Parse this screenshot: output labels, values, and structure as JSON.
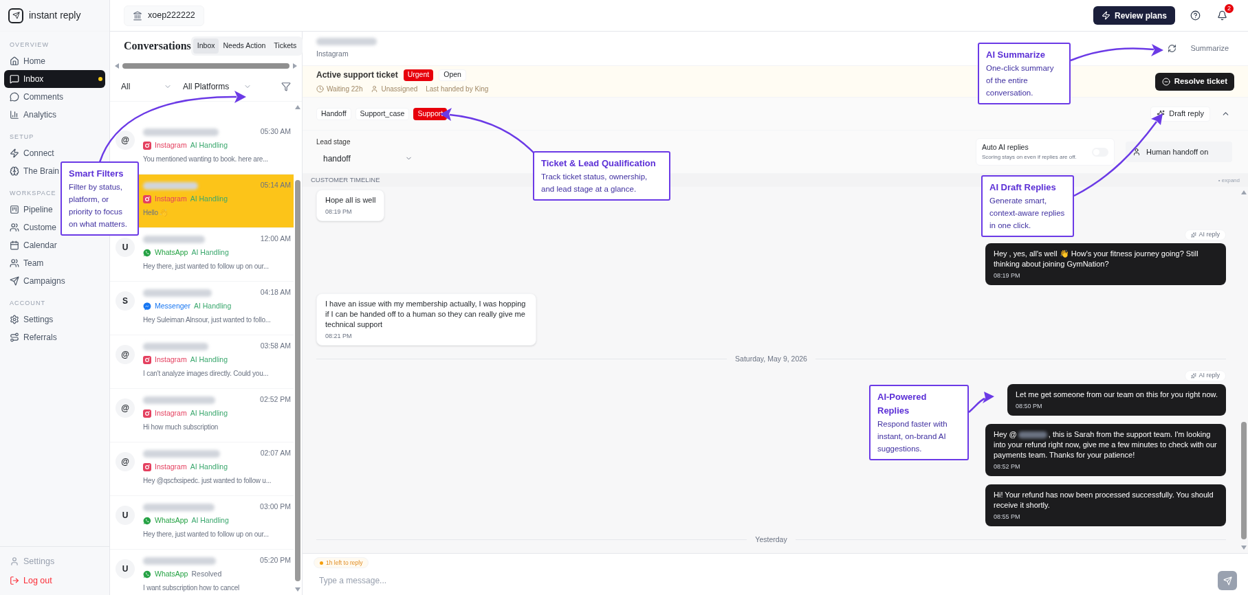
{
  "app": {
    "name": "instant reply"
  },
  "topbar": {
    "workspace": "xoep222222",
    "upgrade_button": "Review plans",
    "notification_count": "2"
  },
  "sidebar": {
    "sections": [
      {
        "title": "OVERVIEW",
        "items": [
          {
            "label": "Home",
            "selected": false,
            "unread": false
          },
          {
            "label": "Inbox",
            "selected": true,
            "unread": true
          },
          {
            "label": "Comments",
            "selected": false,
            "unread": false
          },
          {
            "label": "Analytics",
            "selected": false,
            "unread": false
          }
        ]
      },
      {
        "title": "SETUP",
        "items": [
          {
            "label": "Connect",
            "selected": false,
            "unread": false
          },
          {
            "label": "The Brain",
            "selected": false,
            "unread": false
          }
        ]
      },
      {
        "title": "WORKSPACE",
        "items": [
          {
            "label": "Pipeline",
            "selected": false,
            "unread": false
          },
          {
            "label": "Custome",
            "selected": false,
            "unread": false
          },
          {
            "label": "Calendar",
            "selected": false,
            "unread": false
          },
          {
            "label": "Team",
            "selected": false,
            "unread": false
          },
          {
            "label": "Campaigns",
            "selected": false,
            "unread": false
          }
        ]
      },
      {
        "title": "ACCOUNT",
        "items": [
          {
            "label": "Settings",
            "selected": false,
            "unread": false
          },
          {
            "label": "Referrals",
            "selected": false,
            "unread": false
          }
        ]
      }
    ],
    "footer": [
      {
        "label": "Settings",
        "kind": "normal"
      },
      {
        "label": "Log out",
        "kind": "danger"
      }
    ]
  },
  "conversations": {
    "title": "Conversations",
    "tabs": [
      {
        "label": "Inbox",
        "selected": true
      },
      {
        "label": "Needs Action",
        "selected": false
      },
      {
        "label": "Tickets",
        "selected": false
      }
    ],
    "filters": [
      {
        "value": "All"
      },
      {
        "value": "All Platforms"
      }
    ],
    "items": [
      {
        "avatar": "@",
        "time": "05:30 AM",
        "platform": "Instagram",
        "kind": "instagram",
        "color": "#e4405f",
        "status": "AI Handling",
        "ai_handled": true,
        "preview": "You mentioned wanting to book. here are...",
        "selected": false
      },
      {
        "time": "05:14 AM",
        "platform": "Instagram",
        "kind": "instagram",
        "color": "#e4405f",
        "status": "AI Handling",
        "ai_handled": true,
        "preview": "Hello 👋",
        "selected": true
      },
      {
        "avatar": "U",
        "time": "12:00 AM",
        "platform": "WhatsApp",
        "kind": "whatsapp",
        "color": "#25a244",
        "status": "AI Handling",
        "ai_handled": true,
        "preview": "Hey there, just wanted to follow up on our...",
        "selected": false
      },
      {
        "avatar": "S",
        "time": "04:18 AM",
        "platform": "Messenger",
        "kind": "messenger",
        "color": "#1877f2",
        "status": "AI Handling",
        "ai_handled": true,
        "preview": "Hey Suleiman Alnsour, just wanted to follo...",
        "selected": false
      },
      {
        "avatar": "@",
        "time": "03:58 AM",
        "platform": "Instagram",
        "kind": "instagram",
        "color": "#e4405f",
        "status": "AI Handling",
        "ai_handled": true,
        "preview": "I can't analyze images directly. Could you...",
        "selected": false
      },
      {
        "avatar": "@",
        "time": "02:52 PM",
        "platform": "Instagram",
        "kind": "instagram",
        "color": "#e4405f",
        "status": "AI Handling",
        "ai_handled": true,
        "preview": "Hi how much subscription",
        "selected": false
      },
      {
        "avatar": "@",
        "time": "02:07 AM",
        "platform": "Instagram",
        "kind": "instagram",
        "color": "#e4405f",
        "status": "AI Handling",
        "ai_handled": true,
        "preview": "Hey @qscfxsipedc. just wanted to follow u...",
        "selected": false
      },
      {
        "avatar": "U",
        "time": "03:00 PM",
        "platform": "WhatsApp",
        "kind": "whatsapp",
        "color": "#25a244",
        "status": "AI Handling",
        "ai_handled": true,
        "preview": "Hey there, just wanted to follow up on our...",
        "selected": false
      },
      {
        "avatar": "U",
        "time": "05:20 PM",
        "platform": "WhatsApp",
        "kind": "whatsapp",
        "color": "#25a244",
        "status": "Resolved",
        "ai_handled": false,
        "preview": "I want subscription how to cancel",
        "selected": false
      }
    ]
  },
  "contact": {
    "platform": "Instagram",
    "summarize_button": "Summarize"
  },
  "ticket": {
    "title": "Active support ticket",
    "badges": [
      {
        "label": "Urgent",
        "kind": "priority"
      },
      {
        "label": "Open",
        "kind": "status"
      }
    ],
    "meta": [
      {
        "label": "Waiting 22h",
        "kind": "clock"
      },
      {
        "label": "Unassigned",
        "kind": "user"
      },
      {
        "label": "Last handed by King",
        "kind": "plain"
      }
    ],
    "resolve_button": "Resolve ticket"
  },
  "tags": [
    {
      "label": "Handoff",
      "selected": false
    },
    {
      "label": "Support_case",
      "selected": false
    },
    {
      "label": "Support",
      "selected": true
    }
  ],
  "draft_button": "Draft reply",
  "lead_stage": {
    "label": "Lead stage",
    "value": "handoff"
  },
  "auto_replies": {
    "title": "Auto AI replies",
    "hint": "Scoring stays on even if replies are off.",
    "on": false
  },
  "handoff": {
    "label": "Human handoff on"
  },
  "timeline": {
    "title": "CUSTOMER TIMELINE",
    "expand": "• expand",
    "messages": [
      {
        "kind": "incoming",
        "text": "Hope all is well",
        "time": "08:19 PM"
      },
      {
        "kind": "outgoing",
        "ai_label": "AI reply",
        "text": "Hey , yes, all's well 👋 How's your fitness journey going? Still thinking about joining GymNation?",
        "time": "08:19 PM"
      },
      {
        "kind": "incoming",
        "text": "I have an issue with my membership actually, I was hopping if I can be handed off to a human so they can really give me technical support",
        "time": "08:21 PM"
      },
      {
        "kind": "date",
        "text": "Saturday, May 9, 2026"
      },
      {
        "kind": "outgoing",
        "ai_label": "AI reply",
        "text": "Let me get someone from our team on this for you right now.",
        "time": "08:50 PM"
      },
      {
        "kind": "outgoing",
        "text_before": "Hey @",
        "text": ", this is Sarah from the support team. I'm looking into your refund right now, give me a few minutes to check with our payments team. Thanks for your patience!",
        "time": "08:52 PM"
      },
      {
        "kind": "outgoing",
        "text": "Hi! Your refund has now been processed successfully. You should receive it shortly.",
        "time": "08:55 PM"
      },
      {
        "kind": "date",
        "text": "Yesterday"
      }
    ]
  },
  "composer": {
    "deadline": "1h left to reply",
    "placeholder": "Type a message..."
  },
  "callouts": [
    {
      "title": "Smart Filters",
      "body": "Filter by status, platform, or priority to focus on what matters."
    },
    {
      "title": "Ticket & Lead Qualification",
      "body": "Track ticket status, ownership, and lead stage at a glance."
    },
    {
      "title": "AI Summarize",
      "body": "One-click summary of the entire conversation."
    },
    {
      "title": "AI Draft Replies",
      "body": "Generate smart, context-aware replies in one click."
    },
    {
      "title": "AI-Powered Replies",
      "body": "Respond faster with instant, on-brand AI suggestions."
    }
  ]
}
